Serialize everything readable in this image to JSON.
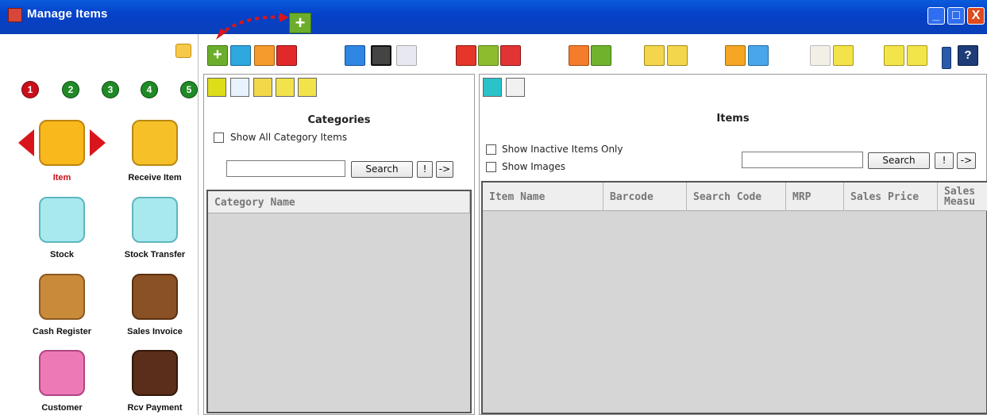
{
  "window": {
    "title": "Manage Items",
    "min_label": "_",
    "max_label": "□",
    "close_label": "X"
  },
  "annotation": {
    "add_label": "+"
  },
  "nav": {
    "steps": [
      "1",
      "2",
      "3",
      "4",
      "5"
    ],
    "items": [
      {
        "label": "Item",
        "icon": "shopping-cart-icon",
        "active": true
      },
      {
        "label": "Receive Item",
        "icon": "truck-icon"
      },
      {
        "label": "Stock",
        "icon": "stock-trolley-icon"
      },
      {
        "label": "Stock Transfer",
        "icon": "stock-transfer-icon"
      },
      {
        "label": "Cash Register",
        "icon": "cash-register-icon"
      },
      {
        "label": "Sales Invoice",
        "icon": "sales-invoice-icon"
      },
      {
        "label": "Customer",
        "icon": "customer-icon"
      },
      {
        "label": "Rcv Payment",
        "icon": "rcv-payment-icon"
      }
    ]
  },
  "toolbar": {
    "add_label": "+",
    "help_label": "?"
  },
  "categories": {
    "title": "Categories",
    "show_all_label": "Show All Category Items",
    "search_value": "",
    "search_button": "Search",
    "bang_button": "!",
    "next_button": "->",
    "columns": [
      "Category Name"
    ]
  },
  "items": {
    "title": "Items",
    "inactive_label": "Show Inactive Items Only",
    "images_label": "Show Images",
    "search_value": "",
    "search_button": "Search",
    "bang_button": "!",
    "next_button": "->",
    "columns": [
      "Item Name",
      "Barcode",
      "Search Code",
      "MRP",
      "Sales Price",
      "Sales Measu"
    ]
  },
  "colors": {
    "titlebar": "#0542c9",
    "accent_red": "#d9151c",
    "step_green": "#1f8a26",
    "grid_bg": "#d6d6d6"
  }
}
